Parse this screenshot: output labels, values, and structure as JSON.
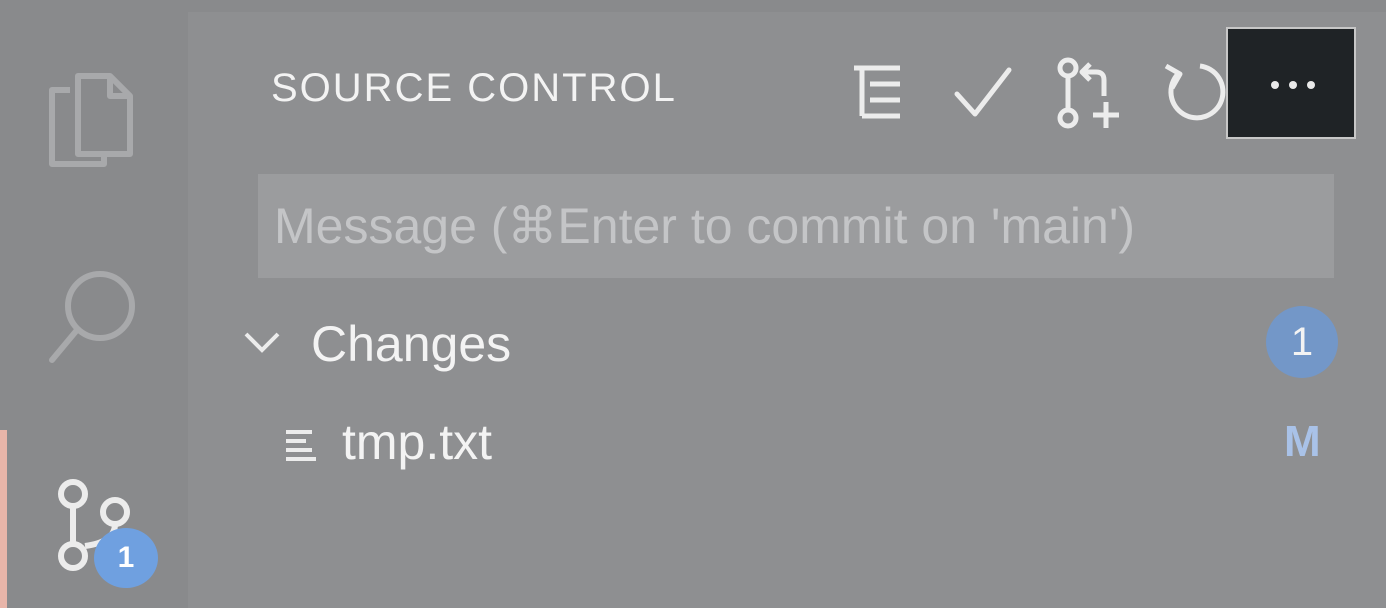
{
  "activity_bar": {
    "items": [
      {
        "name": "explorer",
        "icon": "files-icon"
      },
      {
        "name": "search",
        "icon": "search-icon"
      },
      {
        "name": "source-control",
        "icon": "source-control-icon",
        "badge": "1",
        "active": true
      }
    ]
  },
  "panel": {
    "title": "SOURCE CONTROL",
    "toolbar": [
      {
        "icon": "view-as-tree-icon"
      },
      {
        "icon": "commit-check-icon"
      },
      {
        "icon": "create-pull-request-icon"
      },
      {
        "icon": "refresh-icon"
      },
      {
        "icon": "more-actions-icon"
      }
    ],
    "commit_message": {
      "value": "",
      "placeholder": "Message (⌘Enter to commit on 'main')"
    },
    "changes": {
      "label": "Changes",
      "count": "1",
      "files": [
        {
          "name": "tmp.txt",
          "status": "M",
          "icon": "file-lines-icon"
        }
      ]
    }
  },
  "colors": {
    "background": "#8e8f91",
    "activity_bar": "#898a8c",
    "active_indicator": "#e8b5a9",
    "badge": "#6fa0e0",
    "count_badge": "#7397c8",
    "modified_status": "#a9c2e8",
    "more_button": "#1f2326"
  }
}
